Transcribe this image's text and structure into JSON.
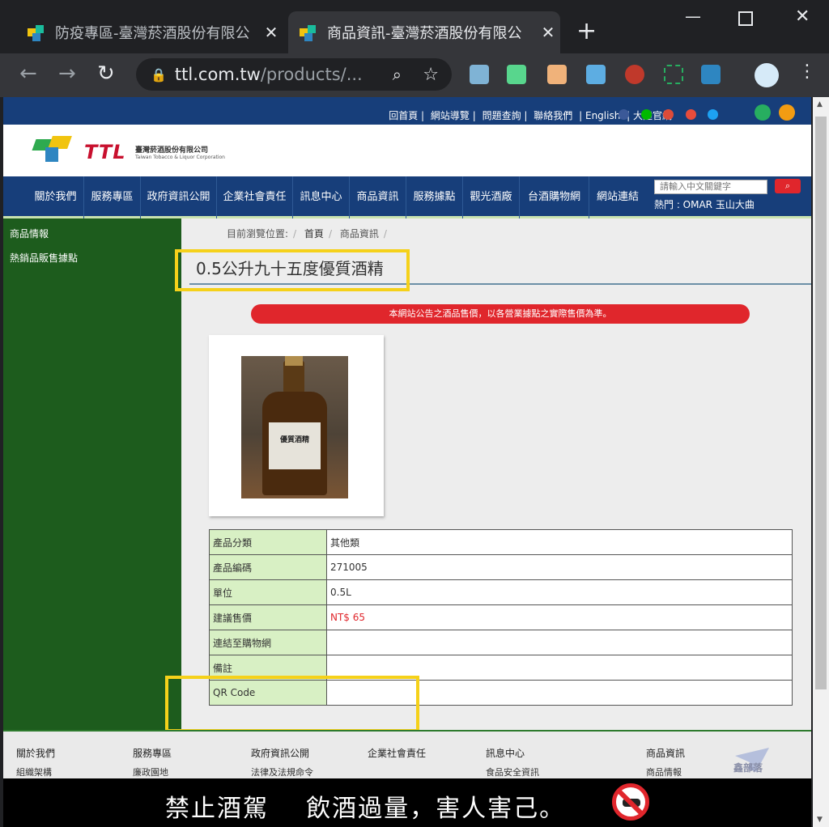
{
  "browser": {
    "tabs": [
      {
        "title": "防疫專區-臺灣菸酒股份有限公",
        "active": false
      },
      {
        "title": "商品資訊-臺灣菸酒股份有限公",
        "active": true
      }
    ],
    "url_host": "ttl.com.tw",
    "url_path": "/products/..."
  },
  "site": {
    "top_links": [
      "回首頁 |",
      "網站導覽 |",
      "問題查詢 |",
      "聯絡我們",
      "| English",
      "| 大陸官網"
    ],
    "logo_text": "TTL",
    "logo_cn": "臺灣菸酒股份有限公司",
    "logo_en": "Taiwan Tobacco & Liquor Corporation",
    "nav": [
      "關於我們",
      "服務專區",
      "政府資訊公開",
      "企業社會責任",
      "訊息中心",
      "商品資訊",
      "服務據點",
      "觀光酒廠",
      "台酒購物網",
      "網站連結"
    ],
    "search_placeholder": "請輸入中文關鍵字",
    "hot": "熱門 : OMAR 玉山大曲"
  },
  "sidebar": {
    "items": [
      "商品情報",
      "熱銷品販售據點"
    ]
  },
  "breadcrumb": {
    "label": "目前瀏覽位置:",
    "items": [
      "首頁",
      "商品資訊"
    ]
  },
  "product": {
    "title": "0.5公升九十五度優質酒精",
    "notice": "本網站公告之酒品售價，以各營業據點之實際售價為準。",
    "label_text": "優質酒精",
    "rows": [
      {
        "key": "產品分類",
        "value": "其他類"
      },
      {
        "key": "產品編碼",
        "value": "271005"
      },
      {
        "key": "單位",
        "value": "0.5L"
      },
      {
        "key": "建議售價",
        "value": "NT$ 65"
      },
      {
        "key": "連結至購物網",
        "value": ""
      },
      {
        "key": "備註",
        "value": ""
      },
      {
        "key": "QR Code",
        "value": ""
      }
    ]
  },
  "footer": {
    "columns": [
      {
        "title": "關於我們",
        "sub": "組織架構"
      },
      {
        "title": "服務專區",
        "sub": "廉政園地"
      },
      {
        "title": "政府資訊公開",
        "sub": "法律及法規命令"
      },
      {
        "title": "企業社會責任",
        "sub": ""
      },
      {
        "title": "訊息中心",
        "sub": "食品安全資訊"
      },
      {
        "title": "商品資訊",
        "sub": "商品情報"
      }
    ],
    "watermark": "鑫部落",
    "banner": "禁止酒駕    飲酒過量，害人害己。"
  },
  "colors": {
    "nav_blue": "#173e7a",
    "sidebar_green": "#1d5c1d",
    "alert_red": "#e0262c",
    "highlight_yellow": "#f5d11a"
  }
}
